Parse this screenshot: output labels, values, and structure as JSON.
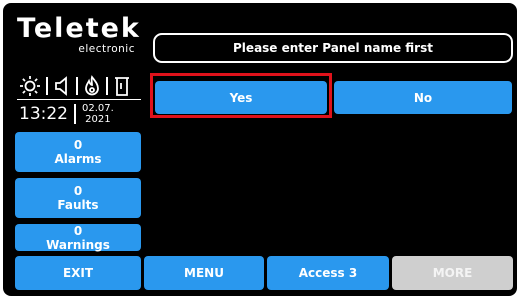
{
  "brand": {
    "name": "Teletek",
    "subtitle": "electronic"
  },
  "status_icons": [
    "brightness-icon",
    "volume-icon",
    "fire-icon",
    "door-icon"
  ],
  "clock": {
    "time": "13:22",
    "date_day_month": "02.07.",
    "date_year": "2021"
  },
  "counters": {
    "alarms": {
      "count": "0",
      "label": "Alarms"
    },
    "faults": {
      "count": "0",
      "label": "Faults"
    },
    "warnings": {
      "count": "0",
      "label": "Warnings"
    }
  },
  "message": "Please enter Panel name first",
  "dialog": {
    "yes_label": "Yes",
    "no_label": "No"
  },
  "bottom_bar": {
    "exit_label": "EXIT",
    "menu_label": "MENU",
    "access_label": "Access 3",
    "more_label": "MORE"
  },
  "colors": {
    "button_blue": "#2a98ee",
    "highlight_red": "#e0121b",
    "disabled_gray": "#cfcfcf"
  }
}
